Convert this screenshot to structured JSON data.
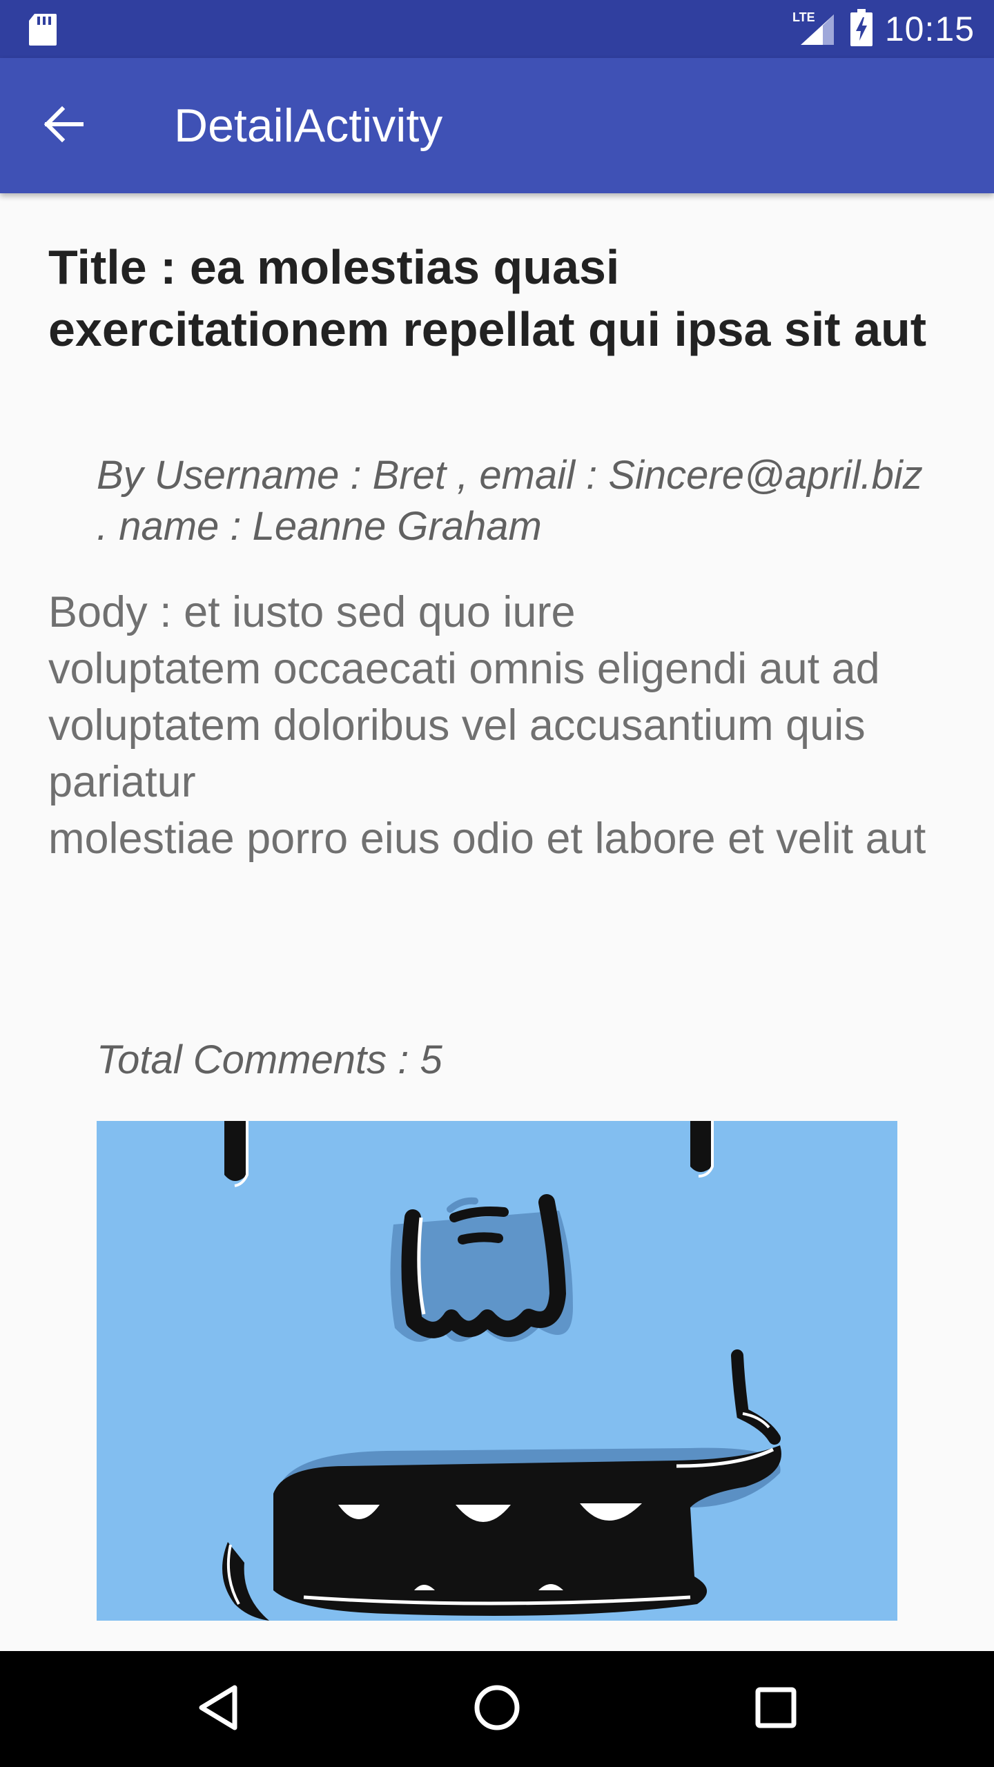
{
  "status_bar": {
    "time": "10:15",
    "network_type": "LTE",
    "icons": [
      "sd-card-icon",
      "lte-signal-icon",
      "battery-charging-icon"
    ]
  },
  "app_bar": {
    "title": "DetailActivity",
    "back_icon": "arrow-back-icon",
    "background_color": "#3f51b5",
    "status_color": "#303f9f"
  },
  "post": {
    "title": "Title :  ea molestias quasi exercitationem repellat qui ipsa sit aut",
    "author_line": "By Username : Bret , email : Sincere@april.biz . name : Leanne Graham",
    "body": "Body : et iusto sed quo iure\nvoluptatem occaecati omnis eligendi aut ad\nvoluptatem doloribus vel accusantium quis pariatur\nmolestiae porro eius odio et labore et velit aut",
    "comments_label": "Total Comments :  5",
    "image_icon": "cartoon-creature-illustration",
    "image_background": "#82bef0"
  },
  "nav_bar": {
    "back": "nav-back-triangle-icon",
    "home": "nav-home-circle-icon",
    "recents": "nav-recents-square-icon"
  }
}
